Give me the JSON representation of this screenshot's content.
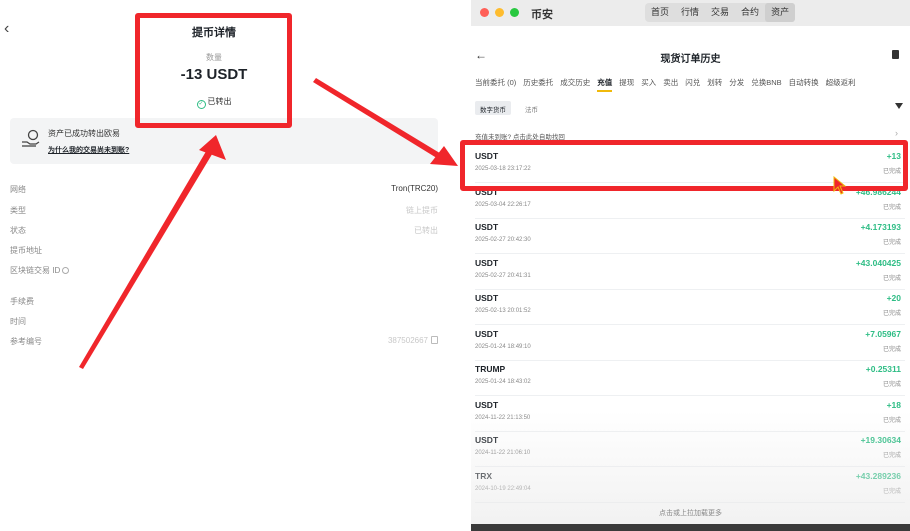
{
  "left": {
    "back": "‹",
    "title": "提币详情",
    "amount_label": "数量",
    "amount": "-13 USDT",
    "status": "已转出",
    "notice": {
      "title": "资产已成功转出欧易",
      "link": "为什么我的交易尚未到账?"
    },
    "rows": [
      {
        "key": "网络",
        "value": "Tron(TRC20)"
      },
      {
        "key": "类型",
        "value": "链上提币"
      },
      {
        "key": "状态",
        "value": "已转出"
      },
      {
        "key": "提币地址",
        "value": ""
      },
      {
        "key": "区块链交易 ID",
        "value": ""
      },
      {
        "key": "手续费",
        "value": ""
      },
      {
        "key": "时间",
        "value": ""
      },
      {
        "key": "参考编号",
        "value": "387502667"
      }
    ]
  },
  "right": {
    "app_name": "币安",
    "nav": [
      "首页",
      "行情",
      "交易",
      "合约",
      "资产"
    ],
    "nav_active": "资产",
    "back": "←",
    "page_title": "现货订单历史",
    "tabs": [
      "当前委托 (0)",
      "历史委托",
      "成交历史",
      "充值",
      "提现",
      "买入",
      "卖出",
      "闪兑",
      "划转",
      "分发",
      "兑换BNB",
      "自动转换",
      "超级返利"
    ],
    "active_tab": "充值",
    "chips": [
      "数字货币",
      "法币"
    ],
    "help_text": "充值未到账? 点击此处自助找回",
    "help_arrow": "›",
    "records": [
      {
        "asset": "USDT",
        "time": "2025-03-18 23:17:22",
        "amount": "+13",
        "status": "已完成"
      },
      {
        "asset": "USDT",
        "time": "2025-03-04 22:26:17",
        "amount": "+46.986244",
        "status": "已完成"
      },
      {
        "asset": "USDT",
        "time": "2025-02-27 20:42:30",
        "amount": "+4.173193",
        "status": "已完成"
      },
      {
        "asset": "USDT",
        "time": "2025-02-27 20:41:31",
        "amount": "+43.040425",
        "status": "已完成"
      },
      {
        "asset": "USDT",
        "time": "2025-02-13 20:01:52",
        "amount": "+20",
        "status": "已完成"
      },
      {
        "asset": "USDT",
        "time": "2025-01-24 18:49:10",
        "amount": "+7.05967",
        "status": "已完成"
      },
      {
        "asset": "TRUMP",
        "time": "2025-01-24 18:43:02",
        "amount": "+0.25311",
        "status": "已完成"
      },
      {
        "asset": "USDT",
        "time": "2024-11-22 21:13:50",
        "amount": "+18",
        "status": "已完成"
      },
      {
        "asset": "USDT",
        "time": "2024-11-22 21:06:10",
        "amount": "+19.30634",
        "status": "已完成"
      },
      {
        "asset": "TRX",
        "time": "2024-10-19 22:49:04",
        "amount": "+43.289236",
        "status": "已完成"
      }
    ],
    "load_more": "点击或上拉加载更多"
  },
  "colors": {
    "highlight": "#f0262b",
    "positive": "#2ebd85",
    "accent": "#f0b90b"
  },
  "icons": [
    "check-circle-icon",
    "exchange-hand-icon",
    "copy-icon",
    "back-arrow-icon",
    "document-icon",
    "filter-icon",
    "mouse-cursor-icon"
  ]
}
